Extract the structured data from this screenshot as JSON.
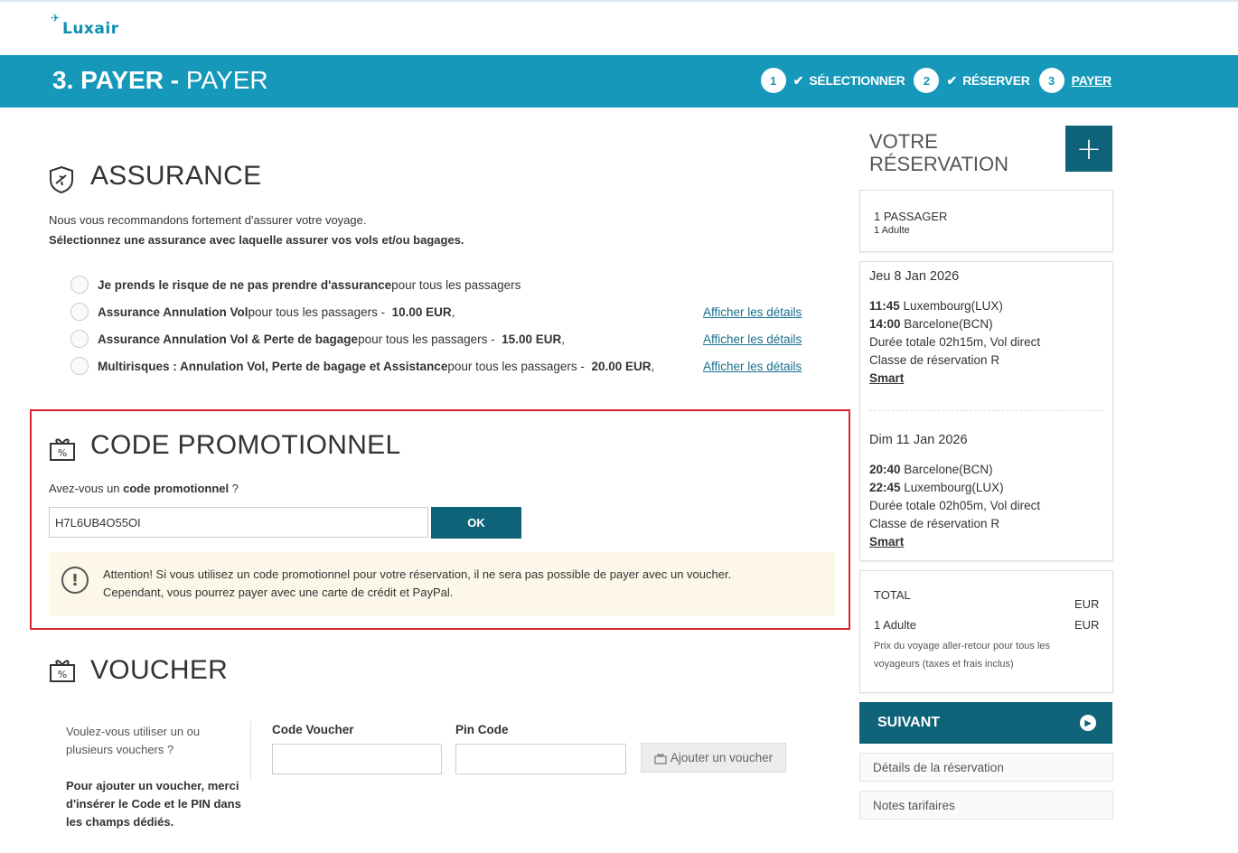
{
  "brand": {
    "name": "Luxair",
    "accent": "#1598ba",
    "dark": "#0e6379",
    "warning_border": "#d9252b"
  },
  "header": {
    "title_bold": "3. PAYER -",
    "title_light": "PAYER",
    "steps": [
      {
        "num": "1",
        "label": "SÉLECTIONNER",
        "done": true
      },
      {
        "num": "2",
        "label": "RÉSERVER",
        "done": true
      },
      {
        "num": "3",
        "label": "PAYER",
        "active": true
      }
    ]
  },
  "insurance": {
    "title": "ASSURANCE",
    "intro": "Nous vous recommandons fortement d'assurer votre voyage.",
    "intro_bold": "Sélectionnez une assurance avec laquelle assurer vos vols et/ou bagages.",
    "options": [
      {
        "bold": "Je prends le risque de ne pas prendre d'assurance",
        "text": " pour tous les passagers",
        "price": "",
        "link": ""
      },
      {
        "bold": "Assurance Annulation Vol",
        "text": " pour tous les passagers - ",
        "price": "10.00  EUR",
        "suffix": ",",
        "link": "Afficher les détails "
      },
      {
        "bold": "Assurance Annulation Vol & Perte de bagage",
        "text": " pour tous les passagers - ",
        "price": "15.00  EUR",
        "suffix": ",",
        "link": "Afficher les détails "
      },
      {
        "bold": "Multirisques : Annulation Vol, Perte de bagage et Assistance",
        "text": " pour tous les passagers - ",
        "price": "20.00  EUR",
        "suffix": ",",
        "link": "Afficher les détails "
      }
    ]
  },
  "promo": {
    "title": "CODE PROMOTIONNEL",
    "question_pre": "Avez-vous un ",
    "question_bold": "code promotionnel",
    "question_post": " ?",
    "value": "H7L6UB4O55OI",
    "ok_label": "OK",
    "warning_line1": "Attention! Si vous utilisez un code promotionnel pour votre réservation, il ne sera pas possible de payer avec un voucher.",
    "warning_line2": "Cependant, vous pourrez payer avec une carte de crédit et PayPal."
  },
  "voucher": {
    "title": "VOUCHER",
    "question": "Voulez-vous utiliser un ou plusieurs vouchers ?",
    "instruction": "Pour ajouter un voucher, merci d'insérer le Code et le PIN dans les champs dédiés.",
    "code_label": "Code Voucher",
    "pin_label": "Pin Code",
    "add_label": "Ajouter un voucher"
  },
  "sidebar": {
    "title_line1": "VOTRE",
    "title_line2": "RÉSERVATION",
    "passengers": "1 PASSAGER",
    "passengers_sub": "1 Adulte",
    "outbound": {
      "date": "Jeu 8 Jan 2026",
      "dep_time": "11:45",
      "dep_place": " Luxembourg(LUX)",
      "arr_time": "14:00",
      "arr_place": " Barcelone(BCN)",
      "duration": "Durée totale 02h15m, Vol direct",
      "class": "Classe de réservation R",
      "fare": "Smart "
    },
    "inbound": {
      "date": "Dim 11 Jan 2026",
      "dep_time": "20:40",
      "dep_place": " Barcelone(BCN)",
      "arr_time": "22:45",
      "arr_place": " Luxembourg(LUX)",
      "duration": "Durée totale 02h05m, Vol direct",
      "class": "Classe de réservation R",
      "fare": "Smart "
    },
    "total_label": "TOTAL",
    "total_currency": "EUR",
    "adult_label": "1 Adulte",
    "adult_currency": "EUR",
    "price_note": "Prix du voyage aller-retour pour tous les voyageurs (taxes et frais inclus)",
    "next_label": "SUIVANT",
    "details_link": "Détails de la réservation",
    "fare_notes_link": "Notes tarifaires"
  }
}
